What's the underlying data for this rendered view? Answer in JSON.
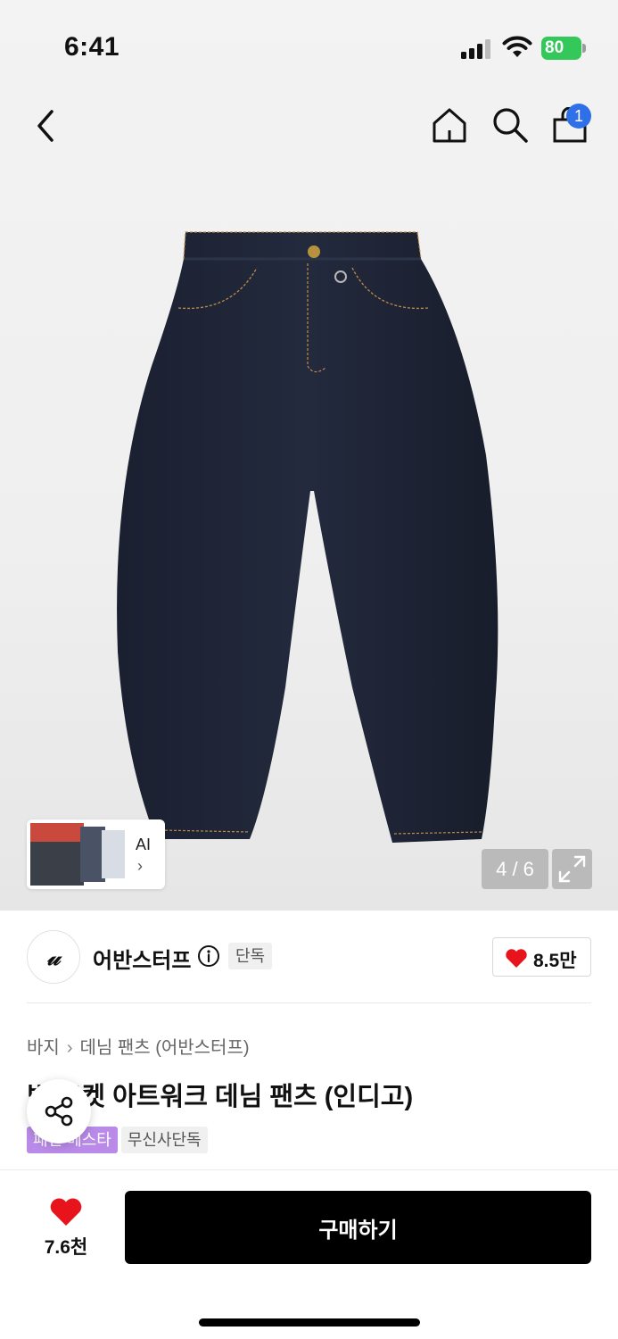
{
  "status_bar": {
    "time": "6:41",
    "battery": "80"
  },
  "nav": {
    "back_icon": "chevron-left-icon",
    "home_icon": "home-icon",
    "search_icon": "search-icon",
    "cart_icon": "shopping-bag-icon",
    "cart_badge": "1"
  },
  "gallery": {
    "ai_label": "AI",
    "ai_chevron": "›",
    "page_counter": "4 / 6",
    "expand_icon": "expand-icon"
  },
  "brand": {
    "logo_text": "𝓊",
    "name": "어반스터프",
    "info_icon": "info-icon",
    "exclusive_tag": "단독",
    "like_count": "8.5만"
  },
  "product": {
    "breadcrumb": [
      "바지",
      "데님 팬츠 (어반스터프)"
    ],
    "title": "빅 포켓 아트워크 데님 팬츠 (인디고)",
    "tags": [
      "패션 베스타",
      "무신사단독"
    ]
  },
  "bottom_bar": {
    "wish_count": "7.6천",
    "buy_label": "구매하기"
  },
  "colors": {
    "accent_blue": "#2f6fe8",
    "heart_red": "#e8141c",
    "tag_purple": "#b98ae8",
    "battery_green": "#34c759",
    "denim": "#1c2233"
  }
}
